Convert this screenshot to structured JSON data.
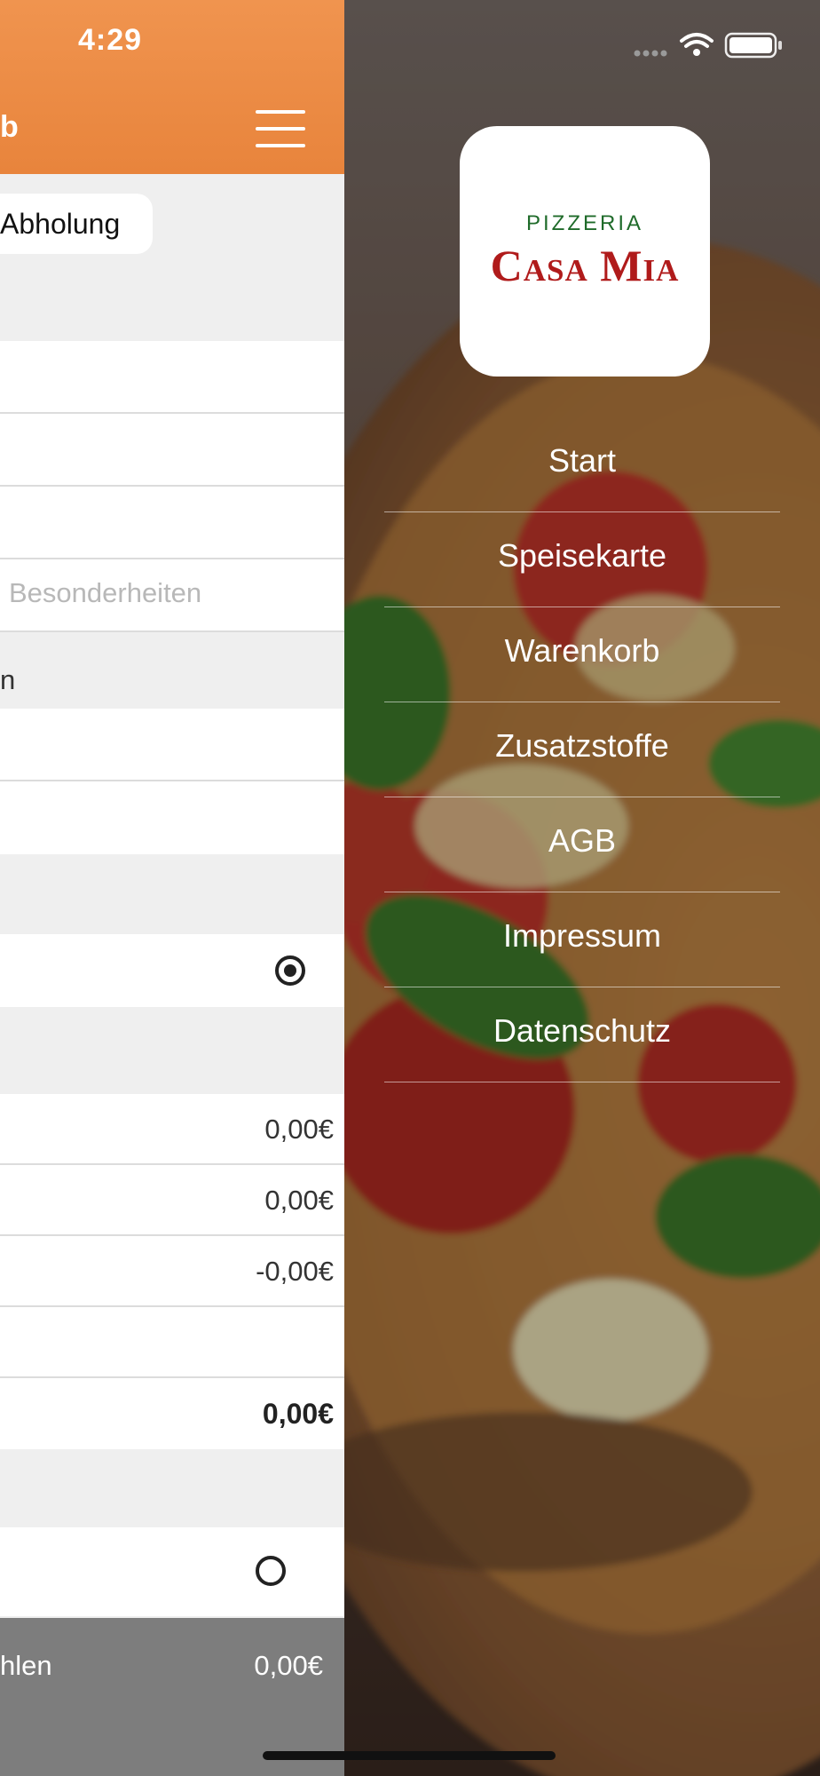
{
  "status_bar": {
    "time": "4:29"
  },
  "cart": {
    "header_title": "b",
    "pickup_pill": "Abholung",
    "note_placeholder": "Besonderheiten",
    "section_text": "n",
    "amounts": [
      "0,00€",
      "0,00€",
      "-0,00€"
    ],
    "total": "0,00€",
    "pay_label": "hlen",
    "pay_amount": "0,00€"
  },
  "logo": {
    "top": "PIZZERIA",
    "main": "Casa Mia"
  },
  "menu": {
    "items": [
      {
        "label": "Start"
      },
      {
        "label": "Speisekarte"
      },
      {
        "label": "Warenkorb"
      },
      {
        "label": "Zusatzstoffe"
      },
      {
        "label": "AGB"
      },
      {
        "label": "Impressum"
      },
      {
        "label": "Datenschutz"
      }
    ]
  },
  "colors": {
    "header_orange": "#ef8f48",
    "logo_red": "#b01b1b",
    "logo_green": "#1f6b2a",
    "pay_bar": "#7d7d7d"
  }
}
